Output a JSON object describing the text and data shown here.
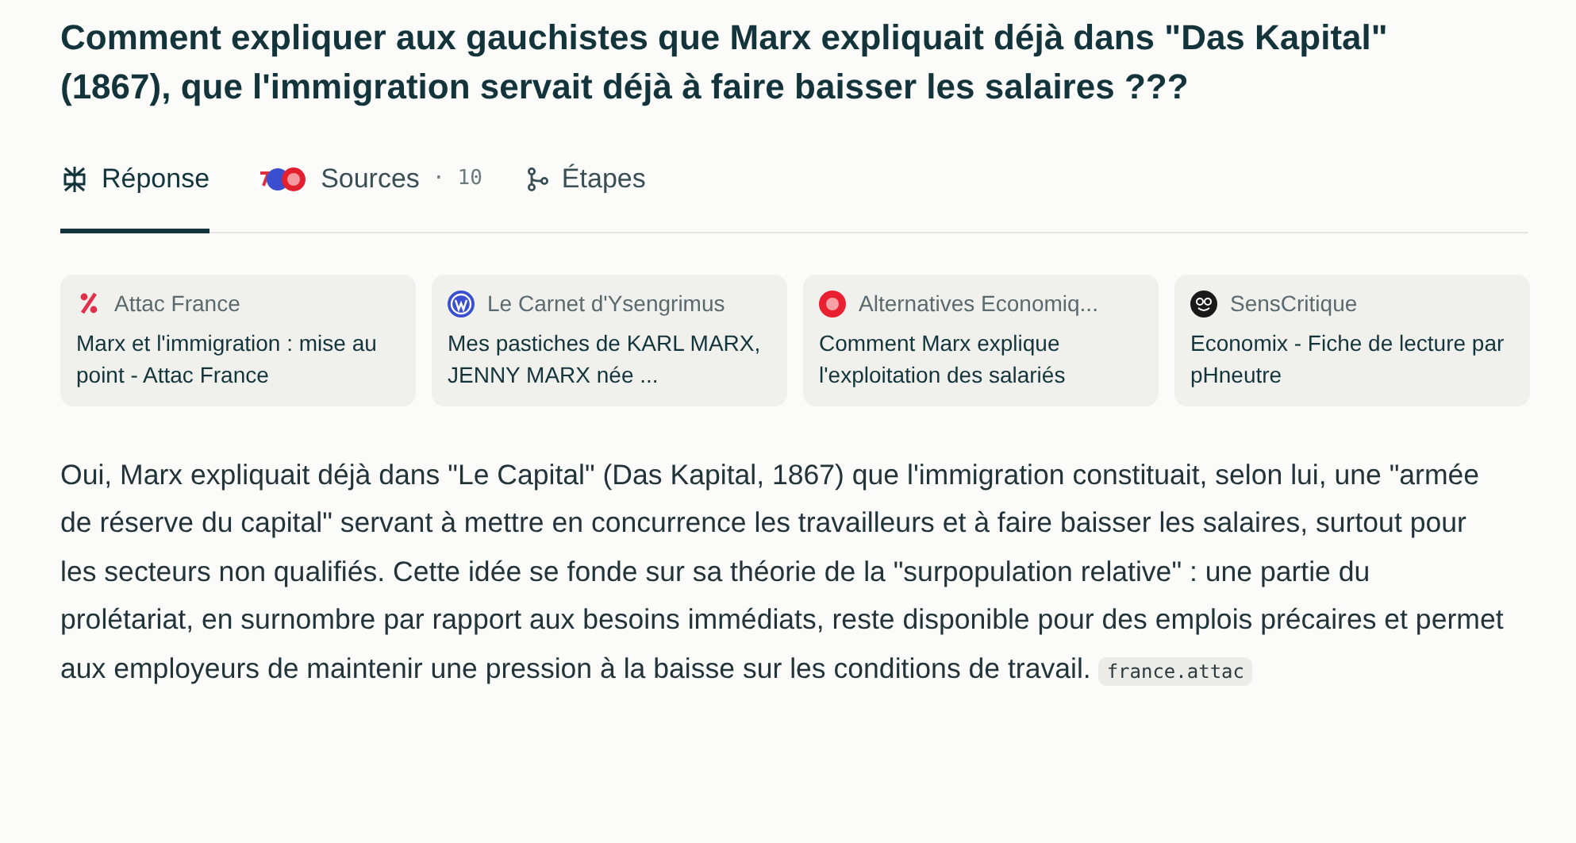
{
  "question": "Comment expliquer aux gauchistes que Marx expliquait déjà dans \"Das Kapital\" (1867), que l'immigration servait déjà à faire baisser les salaires ???",
  "tabs": [
    {
      "kind": "answer",
      "label": "Réponse",
      "selected": true
    },
    {
      "kind": "sources",
      "label": "Sources",
      "separator": "·",
      "count": "10",
      "selected": false
    },
    {
      "kind": "steps",
      "label": "Étapes",
      "selected": false
    }
  ],
  "sources": [
    {
      "kind": "percent",
      "site": "Attac France",
      "title": "Marx et l'immigration : mise au point - Attac France"
    },
    {
      "kind": "wordpress",
      "site": "Le Carnet d'Ysengrimus",
      "title": "Mes pastiches de KARL MARX, JENNY MARX née ..."
    },
    {
      "kind": "redcircle",
      "site": "Alternatives Economiq...",
      "title": "Comment Marx explique l'exploitation des salariés"
    },
    {
      "kind": "blackcircle",
      "site": "SensCritique",
      "title": "Economix - Fiche de lecture par pHneutre"
    }
  ],
  "answer": {
    "text": "Oui, Marx expliquait déjà dans \"Le Capital\" (Das Kapital, 1867) que l'immigration constituait, selon lui, une \"armée de réserve du capital\" servant à mettre en concurrence les travailleurs et à faire baisser les salaires, surtout pour les secteurs non qualifiés. Cette idée se fonde sur sa théorie de la \"surpopulation relative\" : une partie du prolétariat, en surnombre par rapport aux besoins immédiats, reste disponible pour des emplois précaires et permet aux employeurs de maintenir une pression à la baisse sur les conditions de travail.",
    "citation": "france.attac"
  }
}
